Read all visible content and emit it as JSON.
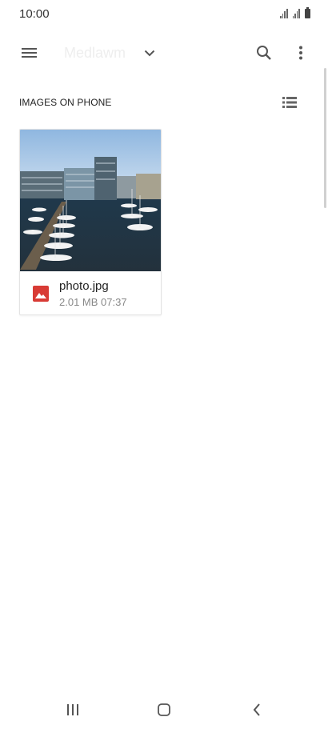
{
  "status_bar": {
    "time": "10:00",
    "icons": [
      "signal-icon",
      "signal-icon",
      "battery-icon"
    ]
  },
  "app_bar": {
    "title": "Medlawm",
    "menu_icon": "hamburger-menu-icon",
    "dropdown_icon": "chevron-down-icon",
    "search_icon": "search-icon",
    "more_icon": "more-vertical-icon"
  },
  "section": {
    "title": "IMAGES ON PHONE",
    "view_icon": "list-view-icon"
  },
  "files": [
    {
      "name": "photo.jpg",
      "meta": "2.01 MB 07:37",
      "icon": "image-file-icon",
      "thumbnail": "harbor-photo"
    }
  ],
  "nav_bar": {
    "recent_icon": "recent-apps-icon",
    "home_icon": "home-icon",
    "back_icon": "back-icon"
  },
  "colors": {
    "file_icon": "#d83b35",
    "icon_gray": "#555555",
    "meta_text": "#888888"
  }
}
